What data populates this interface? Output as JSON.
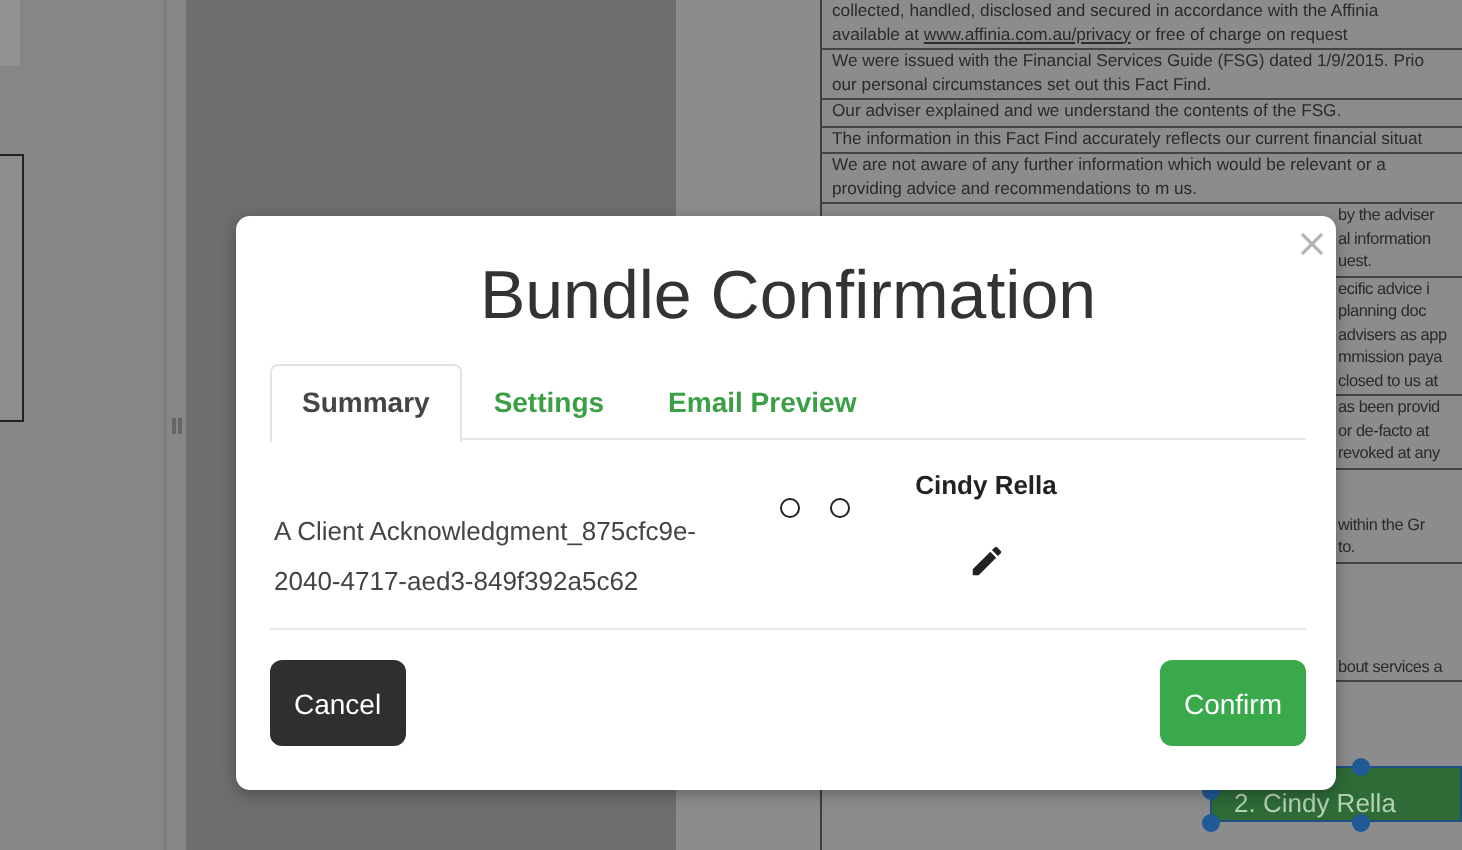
{
  "document": {
    "rows": [
      {
        "kind": "full",
        "lines": [
          {
            "text": "collected, handled, disclosed and secured in accordance with the Affinia"
          },
          {
            "text": "available at ",
            "link": "www.affinia.com.au/privacy",
            "after": " or free of charge on request"
          }
        ]
      },
      {
        "kind": "full",
        "lines": [
          {
            "text": " We were issued with the Financial Services Guide (FSG) dated 1/9/2015. Prio"
          },
          {
            "text": "our personal circumstances set out this Fact Find."
          }
        ]
      },
      {
        "kind": "full",
        "lines": [
          {
            "text": "Our adviser explained and we understand the contents of the FSG."
          }
        ]
      },
      {
        "kind": "full",
        "lines": [
          {
            "text": "The information in this Fact Find accurately reflects our current financial situat"
          }
        ]
      },
      {
        "kind": "full",
        "lines": [
          {
            "text": "We are not aware of any further information which would be relevant or a"
          },
          {
            "text": "providing advice and recommendations to m us."
          }
        ]
      },
      {
        "kind": "fragment",
        "lines": [
          {
            "text": "by the adviser"
          },
          {
            "text": "al information"
          },
          {
            "text": "uest."
          }
        ]
      },
      {
        "kind": "fragment",
        "lines": [
          {
            "text": "ecific advice i"
          },
          {
            "text": "planning doc"
          },
          {
            "text": "advisers as app"
          },
          {
            "text": "mmission paya"
          },
          {
            "text": "closed to us at"
          }
        ]
      },
      {
        "kind": "fragment",
        "lines": [
          {
            "text": "as been provid"
          },
          {
            "text": "or de-facto at"
          },
          {
            "text": "revoked at any"
          }
        ]
      },
      {
        "kind": "fragment",
        "lines": [
          {
            "text": "within the Gr"
          },
          {
            "text": "to."
          }
        ]
      },
      {
        "kind": "fragment",
        "lines": [
          {
            "text": "bout services a"
          }
        ]
      }
    ]
  },
  "signer_field": {
    "label": "2. Cindy Rella",
    "selected": true
  },
  "dialog": {
    "title": "Bundle Confirmation",
    "tabs": [
      {
        "label": "Summary",
        "selected": true
      },
      {
        "label": "Settings",
        "selected": false
      },
      {
        "label": "Email Preview",
        "selected": false
      }
    ],
    "table": {
      "columns": [
        {},
        {
          "label": "Cindy Rella"
        }
      ],
      "rows": [
        {
          "document": "A Client Acknowledgment_875cfc9e-2040-4717-aed3-849f392a5c62"
        }
      ]
    },
    "buttons": [
      {
        "label": "Cancel",
        "kind": "secondary"
      },
      {
        "label": "Confirm",
        "kind": "primary"
      }
    ]
  }
}
